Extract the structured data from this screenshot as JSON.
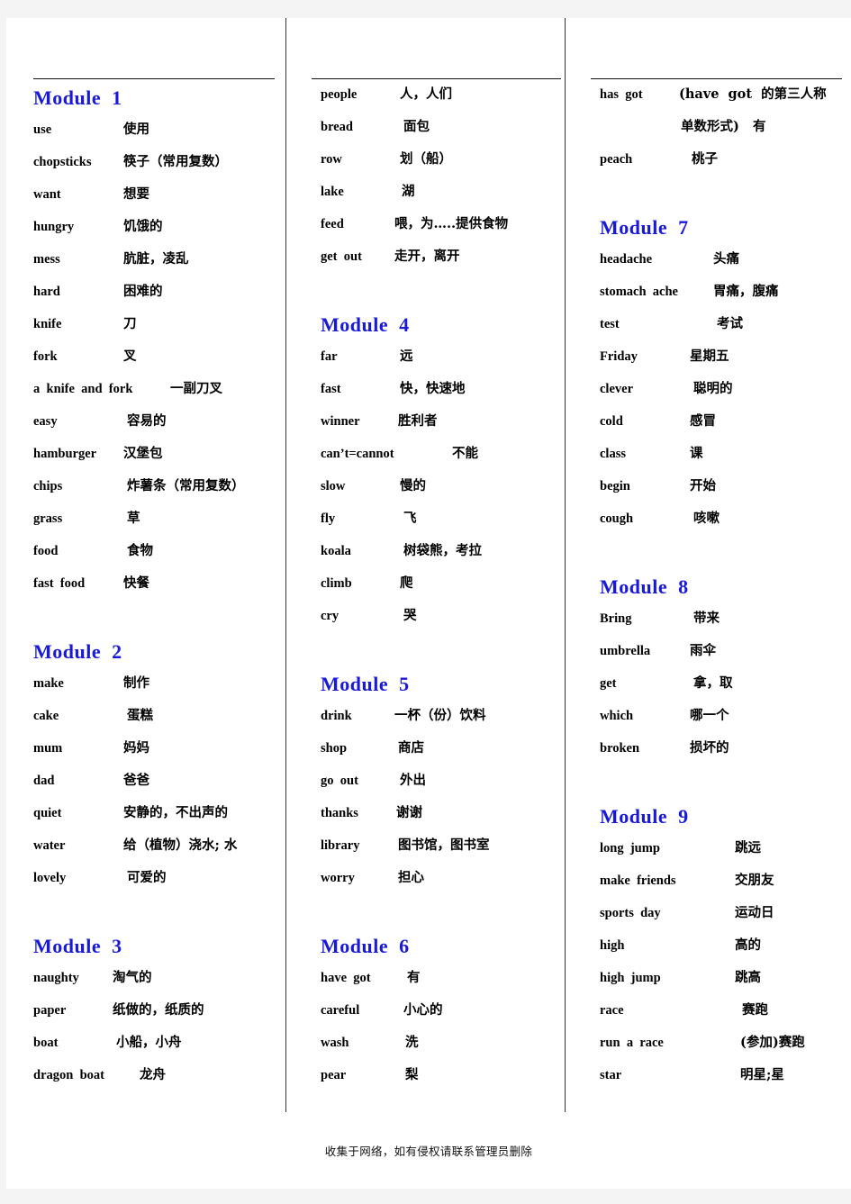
{
  "document": {
    "footer_note": "收集于网络，如有侵权请联系管理员删除",
    "accent_color": "#1919d8",
    "rule_color": "#111111"
  },
  "columns": [
    {
      "id": "column-1",
      "blocks": [
        {
          "heading": "Module  1",
          "entries": [
            {
              "term": "use",
              "def": "使用",
              "indent": 100
            },
            {
              "term": "chopsticks",
              "def": "筷子（常用复数）",
              "indent": 100
            },
            {
              "term": "want",
              "def": "想要",
              "indent": 100
            },
            {
              "term": "hungry",
              "def": "饥饿的",
              "indent": 100
            },
            {
              "term": "mess",
              "def": "肮脏，凌乱",
              "indent": 100
            },
            {
              "term": "hard",
              "def": "困难的",
              "indent": 100
            },
            {
              "term": "knife",
              "def": "刀",
              "indent": 100
            },
            {
              "term": "fork",
              "def": "叉",
              "indent": 100
            },
            {
              "term": "a  knife  and  fork",
              "def": "一副刀叉",
              "indent": 152
            },
            {
              "term": "easy",
              "def": "容易的",
              "indent": 104
            },
            {
              "term": "hamburger",
              "def": "汉堡包",
              "indent": 100
            },
            {
              "term": "chips",
              "def": "炸薯条（常用复数）",
              "indent": 104
            },
            {
              "term": "grass",
              "def": "草",
              "indent": 104
            },
            {
              "term": "food",
              "def": "食物",
              "indent": 104
            },
            {
              "term": "fast  food",
              "def": "快餐",
              "indent": 100
            }
          ]
        },
        {
          "heading": "Module  2",
          "entries": [
            {
              "term": "make",
              "def": "制作",
              "indent": 100
            },
            {
              "term": "cake",
              "def": "蛋糕",
              "indent": 104
            },
            {
              "term": "mum",
              "def": "妈妈",
              "indent": 100
            },
            {
              "term": "dad",
              "def": "爸爸",
              "indent": 100
            },
            {
              "term": "quiet",
              "def": "安静的，不出声的",
              "indent": 100
            },
            {
              "term": "water",
              "def": "给（植物）浇水; 水",
              "indent": 100
            },
            {
              "term": "lovely",
              "def": "可爱的",
              "indent": 104
            }
          ]
        },
        {
          "heading": "Module  3",
          "entries": [
            {
              "term": "naughty",
              "def": "淘气的",
              "indent": 88
            },
            {
              "term": "paper",
              "def": "纸做的，纸质的",
              "indent": 88
            },
            {
              "term": "boat",
              "def": "小船，小舟",
              "indent": 92
            },
            {
              "term": "dragon  boat",
              "def": "龙舟",
              "indent": 118
            }
          ]
        }
      ]
    },
    {
      "id": "column-2",
      "blocks": [
        {
          "heading": null,
          "entries": [
            {
              "term": "people",
              "def": "人，人们",
              "indent": 88
            },
            {
              "term": "bread",
              "def": "面包",
              "indent": 92
            },
            {
              "term": "row",
              "def": "划（船）",
              "indent": 88
            },
            {
              "term": "lake",
              "def": "湖",
              "indent": 90
            },
            {
              "term": "feed",
              "def": "喂，为…..提供食物",
              "indent": 82
            },
            {
              "term": "get  out",
              "def": "走开，离开",
              "indent": 82
            }
          ]
        },
        {
          "heading": "Module  4",
          "entries": [
            {
              "term": "far",
              "def": "远",
              "indent": 88
            },
            {
              "term": "fast",
              "def": "快，快速地",
              "indent": 88
            },
            {
              "term": "winner",
              "def": "胜利者",
              "indent": 86
            },
            {
              "term": "can’t=cannot",
              "def": "不能",
              "indent": 146
            },
            {
              "term": "slow",
              "def": "慢的",
              "indent": 88
            },
            {
              "term": "fly",
              "def": "飞",
              "indent": 92
            },
            {
              "term": "koala",
              "def": "树袋熊，考拉",
              "indent": 92
            },
            {
              "term": "climb",
              "def": "爬",
              "indent": 88
            },
            {
              "term": "cry",
              "def": "哭",
              "indent": 92
            }
          ]
        },
        {
          "heading": "Module  5",
          "entries": [
            {
              "term": "drink",
              "def": "一杯（份）饮料",
              "indent": 82
            },
            {
              "term": "shop",
              "def": "商店",
              "indent": 86
            },
            {
              "term": "go  out",
              "def": "外出",
              "indent": 88
            },
            {
              "term": "thanks",
              "def": "谢谢",
              "indent": 84
            },
            {
              "term": "library",
              "def": "图书馆，图书室",
              "indent": 86
            },
            {
              "term": "worry",
              "def": "担心",
              "indent": 86
            }
          ]
        },
        {
          "heading": "Module  6",
          "entries": [
            {
              "term": "have  got",
              "def": "有",
              "indent": 96
            },
            {
              "term": "careful",
              "def": "小心的",
              "indent": 92
            },
            {
              "term": "wash",
              "def": "洗",
              "indent": 94
            },
            {
              "term": "pear",
              "def": "梨",
              "indent": 94
            }
          ]
        }
      ]
    },
    {
      "id": "column-3",
      "blocks": [
        {
          "heading": null,
          "entries": [
            {
              "term": "has  got",
              "def": "(have  got  的第三人称",
              "indent": 88
            },
            {
              "term": "",
              "def": "单数形式)   有",
              "indent": 0
            },
            {
              "term": "peach",
              "def": "桃子",
              "indent": 102
            }
          ]
        },
        {
          "heading": "Module  7",
          "entries": [
            {
              "term": "headache",
              "def": "头痛",
              "indent": 126
            },
            {
              "term": "stomach  ache",
              "def": "胃痛，腹痛",
              "indent": 126
            },
            {
              "term": "test",
              "def": "考试",
              "indent": 130
            },
            {
              "term": "Friday",
              "def": "星期五",
              "indent": 100
            },
            {
              "term": "clever",
              "def": "聪明的",
              "indent": 104
            },
            {
              "term": "cold",
              "def": "感冒",
              "indent": 100
            },
            {
              "term": "class",
              "def": "课",
              "indent": 100
            },
            {
              "term": "begin",
              "def": "开始",
              "indent": 100
            },
            {
              "term": "cough",
              "def": "咳嗽",
              "indent": 104
            }
          ]
        },
        {
          "heading": "Module  8",
          "entries": [
            {
              "term": "Bring",
              "def": "带来",
              "indent": 104
            },
            {
              "term": "umbrella",
              "def": "雨伞",
              "indent": 100
            },
            {
              "term": "get",
              "def": "拿，取",
              "indent": 104
            },
            {
              "term": "which",
              "def": "哪一个",
              "indent": 100
            },
            {
              "term": "broken",
              "def": "损坏的",
              "indent": 100
            }
          ]
        },
        {
          "heading": "Module  9",
          "entries": [
            {
              "term": "long  jump",
              "def": "跳远",
              "indent": 150
            },
            {
              "term": "make  friends",
              "def": "交朋友",
              "indent": 150
            },
            {
              "term": "sports  day",
              "def": "运动日",
              "indent": 150
            },
            {
              "term": "high",
              "def": "高的",
              "indent": 150
            },
            {
              "term": "high  jump",
              "def": "跳高",
              "indent": 150
            },
            {
              "term": "race",
              "def": "赛跑",
              "indent": 158
            },
            {
              "term": "run  a  race",
              "def": "(参加)赛跑",
              "indent": 156
            },
            {
              "term": "star",
              "def": "明星;星",
              "indent": 156
            }
          ]
        }
      ]
    }
  ]
}
